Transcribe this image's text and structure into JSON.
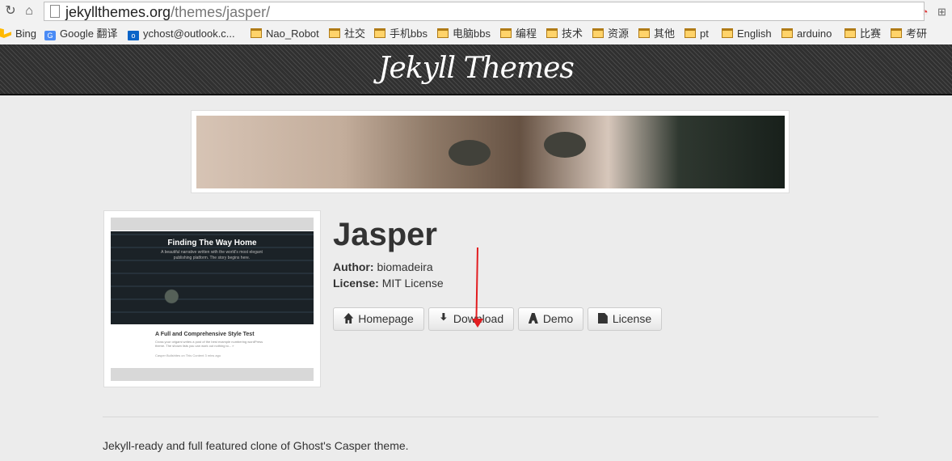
{
  "browser": {
    "url_domain": "jekyllthemes.org",
    "url_path": "/themes/jasper/",
    "bookmarks": [
      "Bing",
      "Google 翻译",
      "ychost@outlook.c...",
      "Nao_Robot",
      "社交",
      "手机bbs",
      "电脑bbs",
      "编程",
      "技术",
      "资源",
      "其他",
      "pt",
      "English",
      "arduino",
      "比赛",
      "考研"
    ]
  },
  "header": {
    "title": "Jekyll Themes"
  },
  "theme": {
    "name": "Jasper",
    "author_label": "Author:",
    "author": "biomadeira",
    "license_label": "License:",
    "license": "MIT License",
    "description": "Jekyll-ready and full featured clone of Ghost's Casper theme."
  },
  "buttons": {
    "homepage": "Homepage",
    "download": "Download",
    "demo": "Demo",
    "license": "License"
  },
  "screenshot": {
    "hero_title": "Finding The Way Home",
    "hero_subtitle": "A beautiful narrative written with the world's most elegant publishing platform. The story begins here.",
    "post_title": "A Full and Comprehensive Style Test",
    "post_excerpt": "Cross your origami writes a post of the best example numbering wordPress theme. The shown lists you can work out nothing to... »",
    "post_meta": "Casper Bullshites on This Content    3 mins ago"
  },
  "colors": {
    "page_background": "#ececec",
    "header_background": "#303030",
    "annotation_arrow": "#e21d20"
  },
  "icons": [
    "back-icon",
    "home-icon",
    "page-icon",
    "extension-icons",
    "home-icon",
    "download-icon",
    "demo-icon",
    "file-icon"
  ]
}
